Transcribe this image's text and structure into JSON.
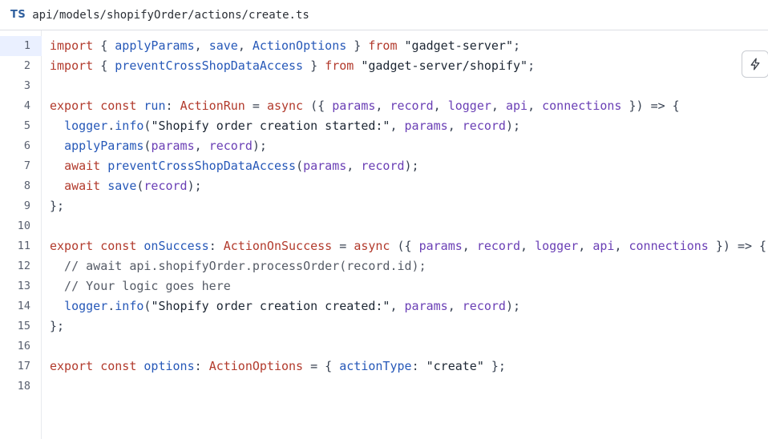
{
  "file": {
    "badge": "TS",
    "path": "api/models/shopifyOrder/actions/create.ts"
  },
  "editor": {
    "active_line": 1,
    "line_numbers": [
      "1",
      "2",
      "3",
      "4",
      "5",
      "6",
      "7",
      "8",
      "9",
      "10",
      "11",
      "12",
      "13",
      "14",
      "15",
      "16",
      "17",
      "18"
    ],
    "lines": [
      [
        [
          "kw",
          "import"
        ],
        [
          "pl",
          " { "
        ],
        [
          "fn",
          "applyParams"
        ],
        [
          "pl",
          ", "
        ],
        [
          "fn",
          "save"
        ],
        [
          "pl",
          ", "
        ],
        [
          "fn",
          "ActionOptions"
        ],
        [
          "pl",
          " } "
        ],
        [
          "kw",
          "from"
        ],
        [
          "pl",
          " "
        ],
        [
          "str",
          "\"gadget-server\""
        ],
        [
          "pl",
          ";"
        ]
      ],
      [
        [
          "kw",
          "import"
        ],
        [
          "pl",
          " { "
        ],
        [
          "fn",
          "preventCrossShopDataAccess"
        ],
        [
          "pl",
          " } "
        ],
        [
          "kw",
          "from"
        ],
        [
          "pl",
          " "
        ],
        [
          "str",
          "\"gadget-server/shopify\""
        ],
        [
          "pl",
          ";"
        ]
      ],
      [],
      [
        [
          "kw",
          "export"
        ],
        [
          "pl",
          " "
        ],
        [
          "kw",
          "const"
        ],
        [
          "pl",
          " "
        ],
        [
          "fn",
          "run"
        ],
        [
          "pl",
          ": "
        ],
        [
          "typ",
          "ActionRun"
        ],
        [
          "pl",
          " = "
        ],
        [
          "kw",
          "async"
        ],
        [
          "pl",
          " ({ "
        ],
        [
          "id",
          "params"
        ],
        [
          "pl",
          ", "
        ],
        [
          "id",
          "record"
        ],
        [
          "pl",
          ", "
        ],
        [
          "id",
          "logger"
        ],
        [
          "pl",
          ", "
        ],
        [
          "id",
          "api"
        ],
        [
          "pl",
          ", "
        ],
        [
          "id",
          "connections"
        ],
        [
          "pl",
          " }) => {"
        ]
      ],
      [
        [
          "pl",
          "  "
        ],
        [
          "fn",
          "logger"
        ],
        [
          "pl",
          "."
        ],
        [
          "fn",
          "info"
        ],
        [
          "pl",
          "("
        ],
        [
          "str",
          "\"Shopify order creation started:\""
        ],
        [
          "pl",
          ", "
        ],
        [
          "id",
          "params"
        ],
        [
          "pl",
          ", "
        ],
        [
          "id",
          "record"
        ],
        [
          "pl",
          ");"
        ]
      ],
      [
        [
          "pl",
          "  "
        ],
        [
          "fn",
          "applyParams"
        ],
        [
          "pl",
          "("
        ],
        [
          "id",
          "params"
        ],
        [
          "pl",
          ", "
        ],
        [
          "id",
          "record"
        ],
        [
          "pl",
          ");"
        ]
      ],
      [
        [
          "pl",
          "  "
        ],
        [
          "kw",
          "await"
        ],
        [
          "pl",
          " "
        ],
        [
          "fn",
          "preventCrossShopDataAccess"
        ],
        [
          "pl",
          "("
        ],
        [
          "id",
          "params"
        ],
        [
          "pl",
          ", "
        ],
        [
          "id",
          "record"
        ],
        [
          "pl",
          ");"
        ]
      ],
      [
        [
          "pl",
          "  "
        ],
        [
          "kw",
          "await"
        ],
        [
          "pl",
          " "
        ],
        [
          "fn",
          "save"
        ],
        [
          "pl",
          "("
        ],
        [
          "id",
          "record"
        ],
        [
          "pl",
          ");"
        ]
      ],
      [
        [
          "pl",
          "};"
        ]
      ],
      [],
      [
        [
          "kw",
          "export"
        ],
        [
          "pl",
          " "
        ],
        [
          "kw",
          "const"
        ],
        [
          "pl",
          " "
        ],
        [
          "fn",
          "onSuccess"
        ],
        [
          "pl",
          ": "
        ],
        [
          "typ",
          "ActionOnSuccess"
        ],
        [
          "pl",
          " = "
        ],
        [
          "kw",
          "async"
        ],
        [
          "pl",
          " ({ "
        ],
        [
          "id",
          "params"
        ],
        [
          "pl",
          ", "
        ],
        [
          "id",
          "record"
        ],
        [
          "pl",
          ", "
        ],
        [
          "id",
          "logger"
        ],
        [
          "pl",
          ", "
        ],
        [
          "id",
          "api"
        ],
        [
          "pl",
          ", "
        ],
        [
          "id",
          "connections"
        ],
        [
          "pl",
          " }) => {"
        ]
      ],
      [
        [
          "cmt",
          "  // await api.shopifyOrder.processOrder(record.id);"
        ]
      ],
      [
        [
          "cmt",
          "  // Your logic goes here"
        ]
      ],
      [
        [
          "pl",
          "  "
        ],
        [
          "fn",
          "logger"
        ],
        [
          "pl",
          "."
        ],
        [
          "fn",
          "info"
        ],
        [
          "pl",
          "("
        ],
        [
          "str",
          "\"Shopify order creation created:\""
        ],
        [
          "pl",
          ", "
        ],
        [
          "id",
          "params"
        ],
        [
          "pl",
          ", "
        ],
        [
          "id",
          "record"
        ],
        [
          "pl",
          ");"
        ]
      ],
      [
        [
          "pl",
          "};"
        ]
      ],
      [],
      [
        [
          "kw",
          "export"
        ],
        [
          "pl",
          " "
        ],
        [
          "kw",
          "const"
        ],
        [
          "pl",
          " "
        ],
        [
          "fn",
          "options"
        ],
        [
          "pl",
          ": "
        ],
        [
          "typ",
          "ActionOptions"
        ],
        [
          "pl",
          " = { "
        ],
        [
          "fn",
          "actionType"
        ],
        [
          "pl",
          ": "
        ],
        [
          "str",
          "\"create\""
        ],
        [
          "pl",
          " };"
        ]
      ],
      []
    ]
  },
  "action_button": {
    "icon": "lightning-icon"
  },
  "colors": {
    "keyword": "#b23a2c",
    "function": "#2658b8",
    "string": "#1c2633",
    "identifier": "#6a3fb5",
    "comment": "#555b66",
    "badge": "#2f5f9e",
    "active_line": "#eaf0ff"
  }
}
